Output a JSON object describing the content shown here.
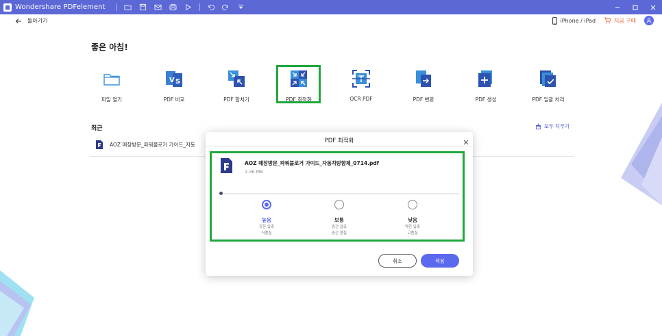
{
  "window": {
    "title": "Wondershare PDFelement"
  },
  "topbar": {
    "back_label": "돌아가기",
    "device_label": "iPhone / iPad",
    "buy_label": "지금 구매"
  },
  "home": {
    "greeting": "좋은 아침!",
    "tools": [
      {
        "label": "파일 열기",
        "icon": "folder-icon"
      },
      {
        "label": "PDF 비교",
        "icon": "compare-icon"
      },
      {
        "label": "PDF 합치기",
        "icon": "merge-icon"
      },
      {
        "label": "PDF 최적화",
        "icon": "optimize-icon"
      },
      {
        "label": "OCR PDF",
        "icon": "ocr-icon"
      },
      {
        "label": "PDF 변환",
        "icon": "convert-icon"
      },
      {
        "label": "PDF 생성",
        "icon": "create-icon"
      },
      {
        "label": "PDF 일괄 처리",
        "icon": "batch-icon"
      }
    ],
    "recent_title": "최근",
    "clear_all_label": "모두 지우기",
    "recent_files": [
      {
        "name": "AOZ 매장방문_파워블로거 가이드_자동"
      }
    ]
  },
  "dialog": {
    "title": "PDF 최적화",
    "file_name": "AOZ 매장방문_파워블로거 가이드_자동차방향제_0714.pdf",
    "file_size": "1.36 MB",
    "options": [
      {
        "label": "높음",
        "desc1": "강한 압축",
        "desc2": "저품질",
        "selected": true
      },
      {
        "label": "보통",
        "desc1": "중간 압축",
        "desc2": "중간 품질",
        "selected": false
      },
      {
        "label": "낮음",
        "desc1": "약한 압축",
        "desc2": "고품질",
        "selected": false
      }
    ],
    "cancel_label": "취소",
    "apply_label": "적용"
  },
  "colors": {
    "titlebar": "#5c68d6",
    "accent": "#5b69ee",
    "highlight": "#1ea83c",
    "buy": "#ef6c3c"
  }
}
